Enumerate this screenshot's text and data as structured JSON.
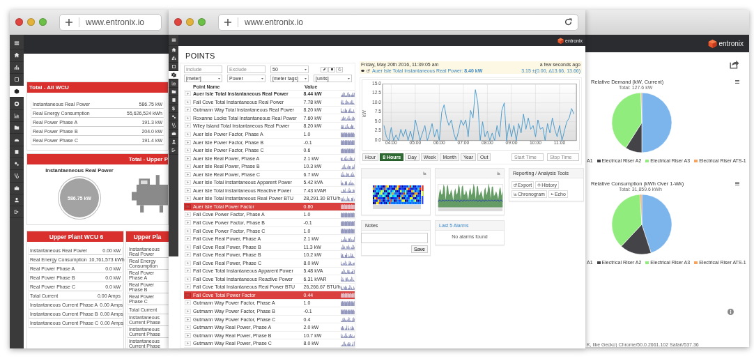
{
  "left_window": {
    "url": "www.entronix.io",
    "sidebar": [
      {
        "kind": "menu",
        "selected": false
      },
      {
        "kind": "home",
        "selected": false
      },
      {
        "kind": "sitemap",
        "selected": false
      },
      {
        "kind": "square",
        "selected": false
      },
      {
        "kind": "cube",
        "selected": true
      },
      {
        "kind": "disc",
        "selected": false
      },
      {
        "kind": "chart",
        "selected": false
      },
      {
        "kind": "folder",
        "selected": false
      },
      {
        "kind": "gauge",
        "selected": false
      },
      {
        "kind": "book",
        "selected": false
      },
      {
        "kind": "gears",
        "selected": false
      },
      {
        "kind": "stethoscope",
        "selected": false
      },
      {
        "kind": "briefcase",
        "selected": false
      },
      {
        "kind": "user",
        "selected": false
      },
      {
        "kind": "logout",
        "selected": false
      }
    ],
    "total_all": {
      "title": "Total - All WCU",
      "rows": [
        {
          "label": "Instantaneous Real Power",
          "value": "586.75 kW"
        },
        {
          "label": "Real Energy Consumption",
          "value": "55,626,524 kWh"
        },
        {
          "label": "Real Power Phase A",
          "value": "191.3 kW"
        },
        {
          "label": "Real Power Phase B",
          "value": "204.0 kW"
        },
        {
          "label": "Real Power Phase C",
          "value": "191.4 kW"
        }
      ]
    },
    "total_upper": {
      "title": "Total - Upper P",
      "gauge_label": "Instantaeneous Real Power",
      "gauge_value": "586.75 kW"
    },
    "plants": [
      {
        "title": "Upper Plant WCU 6",
        "rows": [
          {
            "label": "Instantaneous Real Power",
            "value": "0.00 kW"
          },
          {
            "label": "Real Energy Consumption",
            "value": "10,761,573 kWh"
          },
          {
            "label": "Real Power Phase A",
            "value": "0.0 kW"
          },
          {
            "label": "Real Power Phase B",
            "value": "0.0 kW"
          },
          {
            "label": "Real Power Phase C",
            "value": "0.0 kW"
          },
          {
            "label": "Total Current",
            "value": "0.00 Amps"
          },
          {
            "label": "Instantaneous Current Phase A",
            "value": "0.00 Amps"
          },
          {
            "label": "Instantaneous Current Phase B",
            "value": "0.00 Amps"
          },
          {
            "label": "Instantaneous Current Phase C",
            "value": "0.00 Amps"
          }
        ]
      },
      {
        "title": "Upper Pla",
        "rows": [
          {
            "label": "Instantaneous Real Power"
          },
          {
            "label": "Real Energy Consumption"
          },
          {
            "label": "Real Power Phase A"
          },
          {
            "label": "Real Power Phase B"
          },
          {
            "label": "Real Power Phase C"
          },
          {
            "label": "Total Current"
          },
          {
            "label": "Instantaneous Current Phase"
          },
          {
            "label": "Instantaneous Current Phase"
          },
          {
            "label": "Instantaneous Current Phase"
          }
        ]
      }
    ]
  },
  "points_window": {
    "url": "www.entronix.io",
    "logo": "entronix",
    "sidebar": [
      {
        "kind": "menu",
        "selected": false
      },
      {
        "kind": "home",
        "selected": false
      },
      {
        "kind": "sitemap",
        "selected": false
      },
      {
        "kind": "square",
        "selected": false
      },
      {
        "kind": "gear",
        "selected": true
      },
      {
        "kind": "chart",
        "selected": false
      },
      {
        "kind": "folder",
        "selected": false
      },
      {
        "kind": "book",
        "selected": false
      },
      {
        "kind": "glyph",
        "text": "$",
        "selected": false
      },
      {
        "kind": "gears",
        "selected": false
      },
      {
        "kind": "stethoscope",
        "selected": false
      },
      {
        "kind": "briefcase",
        "selected": false
      },
      {
        "kind": "user",
        "selected": false
      },
      {
        "kind": "logout",
        "selected": false
      }
    ],
    "title": "POINTS",
    "fields": [
      {
        "placeholder": "Include"
      },
      {
        "placeholder": "Exclude"
      }
    ],
    "page_size": "50",
    "selects": [
      "[meter]",
      "Power",
      "[meter tags]",
      "[units]"
    ],
    "table": {
      "columns": [
        "Point Name",
        "Value"
      ],
      "rows": [
        {
          "name": "Auer Isle Total Instantaneous Real Power",
          "value": "8.44 kW",
          "selected": true,
          "alarm": false
        },
        {
          "name": "Fall Cove Total Instantaneous Real Power",
          "value": "7.78 kW",
          "selected": false,
          "alarm": false
        },
        {
          "name": "Gutmann Way Total Instantaneous Real Power",
          "value": "8.20 kW",
          "selected": false,
          "alarm": false
        },
        {
          "name": "Roxanne Locks Total Instantaneous Real Power",
          "value": "7.60 kW",
          "selected": false,
          "alarm": false
        },
        {
          "name": "Wiley Island Total Instantaneous Real Power",
          "value": "8.20 kW",
          "selected": false,
          "alarm": false
        },
        {
          "name": "Auer Isle Power Factor, Phase A",
          "value": "1.0",
          "selected": false,
          "alarm": false
        },
        {
          "name": "Auer Isle Power Factor, Phase B",
          "value": "-0.1",
          "selected": false,
          "alarm": false
        },
        {
          "name": "Auer Isle Power Factor, Phase C",
          "value": "0.6",
          "selected": false,
          "alarm": false
        },
        {
          "name": "Auer Isle Real Power, Phase A",
          "value": "2.1 kW",
          "selected": false,
          "alarm": false
        },
        {
          "name": "Auer Isle Real Power, Phase B",
          "value": "10.3 kW",
          "selected": false,
          "alarm": false
        },
        {
          "name": "Auer Isle Real Power, Phase C",
          "value": "6.7 kW",
          "selected": false,
          "alarm": false
        },
        {
          "name": "Auer Isle Total Instantaneous Apparent Power",
          "value": "5.42 kVA",
          "selected": false,
          "alarm": false
        },
        {
          "name": "Auer Isle Total Instantaneous Reactive Power",
          "value": "7.43 kVAR",
          "selected": false,
          "alarm": false
        },
        {
          "name": "Auer Isle Total Instantaneous Real Power BTU",
          "value": "28,291.30 BTU/h",
          "selected": false,
          "alarm": false
        },
        {
          "name": "Auer Isle Total Power Factor",
          "value": "0.80",
          "selected": false,
          "alarm": true
        },
        {
          "name": "Fall Cove Power Factor, Phase A",
          "value": "1.0",
          "selected": false,
          "alarm": false
        },
        {
          "name": "Fall Cove Power Factor, Phase B",
          "value": "-0.1",
          "selected": false,
          "alarm": false
        },
        {
          "name": "Fall Cove Power Factor, Phase C",
          "value": "1.0",
          "selected": false,
          "alarm": false
        },
        {
          "name": "Fall Cove Real Power, Phase A",
          "value": "2.1 kW",
          "selected": false,
          "alarm": false
        },
        {
          "name": "Fall Cove Real Power, Phase B",
          "value": "11.3 kW",
          "selected": false,
          "alarm": false
        },
        {
          "name": "Fall Cove Real Power, Phase B",
          "value": "10.2 kW",
          "selected": false,
          "alarm": false
        },
        {
          "name": "Fall Cove Real Power, Phase C",
          "value": "8.0 kW",
          "selected": false,
          "alarm": false
        },
        {
          "name": "Fall Cove Total Instantaneous Apparent Power",
          "value": "5.48 kVA",
          "selected": false,
          "alarm": false
        },
        {
          "name": "Fall Cove Total Instantaneous Reactive Power",
          "value": "6.31 kVAR",
          "selected": false,
          "alarm": false
        },
        {
          "name": "Fall Cove Total Instantaneous Real Power BTU",
          "value": "26,266.67 BTU/h",
          "selected": false,
          "alarm": false
        },
        {
          "name": "Fall Cove Total Power Factor",
          "value": "0.44",
          "selected": false,
          "alarm": true
        },
        {
          "name": "Gutmann Way Power Factor, Phase A",
          "value": "1.0",
          "selected": false,
          "alarm": false
        },
        {
          "name": "Gutmann Way Power Factor, Phase B",
          "value": "-0.1",
          "selected": false,
          "alarm": false
        },
        {
          "name": "Gutmann Way Power Factor, Phase C",
          "value": "0.4",
          "selected": false,
          "alarm": false
        },
        {
          "name": "Gutmann Way Real Power, Phase A",
          "value": "2.0 kW",
          "selected": false,
          "alarm": false
        },
        {
          "name": "Gutmann Way Real Power, Phase B",
          "value": "10.7 kW",
          "selected": false,
          "alarm": false
        },
        {
          "name": "Gutmann Way Real Power, Phase C",
          "value": "8.0 kW",
          "selected": false,
          "alarm": false
        }
      ]
    },
    "info": {
      "date": "Friday, May 20th 2016, 11:39:05 am",
      "ago": "a few seconds ago",
      "point": "Auer Isle Total Instantaneous Real Power: **8.40 kW**",
      "stats": "3.15 ±(0.00, ∆13.66, 13.66)"
    },
    "chart": {
      "chart_data": {
        "type": "line",
        "ylabel": "kW",
        "x": [
          3.7,
          3.8,
          3.9,
          4.0,
          4.1,
          4.2,
          4.3,
          4.4,
          4.5,
          4.6,
          4.7,
          4.8,
          4.9,
          5.0,
          5.1,
          5.2,
          5.3,
          5.4,
          5.5,
          5.6,
          5.7,
          5.8,
          5.9,
          6.0,
          6.1,
          6.2,
          6.3,
          6.4,
          6.5,
          6.6,
          6.7,
          6.8,
          6.9,
          7.0,
          7.1,
          7.2,
          7.3,
          7.4,
          7.5,
          7.6,
          7.7,
          7.8,
          7.9,
          8.0,
          8.1,
          8.2,
          8.3,
          8.4,
          8.5,
          8.6,
          8.7,
          8.8,
          8.9,
          9.0,
          9.1,
          9.2,
          9.3,
          9.4,
          9.5,
          9.6,
          9.7,
          9.8,
          9.9,
          10.0,
          10.1,
          10.2,
          10.3,
          10.4,
          10.5,
          10.6,
          10.7,
          10.8,
          10.9,
          11.0,
          11.1,
          11.2,
          11.3,
          11.4,
          11.5,
          11.6
        ],
        "series": [
          {
            "color": "#4a9acb",
            "values": [
              4,
              1,
              0,
              3.5,
              0,
              1.5,
              0,
              3,
              1,
              3,
              0,
              2.5,
              0,
              5.5,
              3,
              0,
              2,
              4,
              0,
              2,
              4.5,
              1,
              3,
              0,
              7.5,
              9.5,
              6,
              4,
              5.5,
              2,
              0,
              2.5,
              5.5,
              4,
              5.5,
              1,
              8,
              6,
              13.5,
              10,
              0,
              5,
              1,
              2.5,
              0,
              2,
              0,
              4,
              1,
              8,
              10,
              0,
              4.5,
              1,
              4,
              0,
              4.5,
              2,
              7,
              3,
              6,
              3,
              4,
              1,
              5.5,
              3,
              3.5,
              0,
              4.5,
              2,
              6,
              3,
              1,
              4,
              0,
              2.5,
              5,
              6,
              8.5,
              7
            ]
          }
        ],
        "xlim": [
          3.64,
          11.7
        ],
        "ylim": [
          0,
          15
        ],
        "grid": true,
        "xticks": [
          {
            "value": 4,
            "label": "04:00"
          },
          {
            "value": 5,
            "label": "05:00"
          },
          {
            "value": 6,
            "label": "06:00"
          },
          {
            "value": 7,
            "label": "07:00"
          },
          {
            "value": 8,
            "label": "08:00"
          },
          {
            "value": 9,
            "label": "09:00"
          },
          {
            "value": 10,
            "label": "10:00"
          },
          {
            "value": 11,
            "label": "11:00"
          }
        ],
        "yticks": [
          {
            "value": 0,
            "label": "0.0"
          },
          {
            "value": 2.5,
            "label": "2.5"
          },
          {
            "value": 5,
            "label": "5.0"
          },
          {
            "value": 7.5,
            "label": "7.5"
          },
          {
            "value": 10,
            "label": "10.0"
          },
          {
            "value": 12.5,
            "label": "12.5"
          },
          {
            "value": 15,
            "label": "15.0"
          }
        ]
      }
    },
    "ranges": [
      {
        "label": "Hour",
        "selected": false
      },
      {
        "label": "8 Hours",
        "selected": true
      },
      {
        "label": "Day",
        "selected": false
      },
      {
        "label": "Week",
        "selected": false
      },
      {
        "label": "Month",
        "selected": false
      },
      {
        "label": "Year",
        "selected": false
      },
      {
        "label": "Out",
        "selected": false
      }
    ],
    "start_placeholder": "Start Time",
    "stop_placeholder": "Stop Time",
    "tools": {
      "title": "Reporting / Analysis Tools",
      "buttons": [
        {
          "kind": "export",
          "label": "Export"
        },
        {
          "kind": "history",
          "label": "History"
        },
        {
          "kind": "chronogram",
          "label": "Chronogram"
        },
        {
          "kind": "echo",
          "label": "Echo"
        }
      ]
    },
    "notes": {
      "title": "Notes",
      "button": "Save"
    },
    "alarms": {
      "title": "Last 5 Alarms",
      "message": "No alarms found"
    }
  },
  "right_window": {
    "logo": "entronix",
    "charts": [
      {
        "title": "Relative Demand (kW, Current)",
        "subtitle": "Total: 127.6 kW",
        "legend": [
          {
            "label": "A1"
          },
          {
            "label": "Electrical Riser A2",
            "color": "#434348"
          },
          {
            "label": "Electrical Riser A3",
            "color": "#90ed7d"
          },
          {
            "label": "Electrical Riser ATS-1",
            "color": "#f7a35c"
          }
        ]
      },
      {
        "title": "Relative Consumption (kWh Over 1-Wk)",
        "subtitle": "Total: 31,859.6 kWh",
        "legend": [
          {
            "label": "A1"
          },
          {
            "label": "Electrical Riser A2",
            "color": "#434348"
          },
          {
            "label": "Electrical Riser A3",
            "color": "#90ed7d"
          },
          {
            "label": "Electrical Riser ATS-1",
            "color": "#f7a35c"
          }
        ]
      }
    ],
    "footer": "K, like Gecko) Chrome/50.0.2661.102 Safari/537.36"
  }
}
